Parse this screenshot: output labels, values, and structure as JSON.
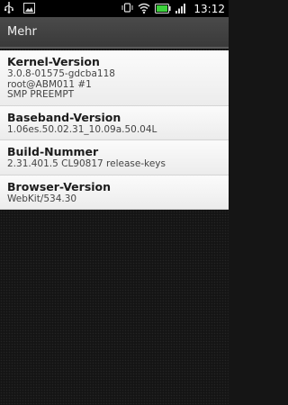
{
  "statusbar": {
    "time": "13:12",
    "icons": [
      "usb-icon",
      "image-icon",
      "vibrate-icon",
      "wifi-icon",
      "battery-icon",
      "signal-icon"
    ]
  },
  "titlebar": {
    "title": "Mehr"
  },
  "items": [
    {
      "label": "Kernel-Version",
      "lines": [
        "3.0.8-01575-gdcba118",
        "root@ABM011 #1",
        "SMP PREEMPT"
      ]
    },
    {
      "label": "Baseband-Version",
      "lines": [
        "1.06es.50.02.31_10.09a.50.04L"
      ]
    },
    {
      "label": "Build-Nummer",
      "lines": [
        "2.31.401.5 CL90817 release-keys"
      ]
    },
    {
      "label": "Browser-Version",
      "lines": [
        "WebKit/534.30"
      ]
    }
  ],
  "colors": {
    "battery_green": "#3cd13c",
    "titlebar": "#3f3f3f"
  }
}
